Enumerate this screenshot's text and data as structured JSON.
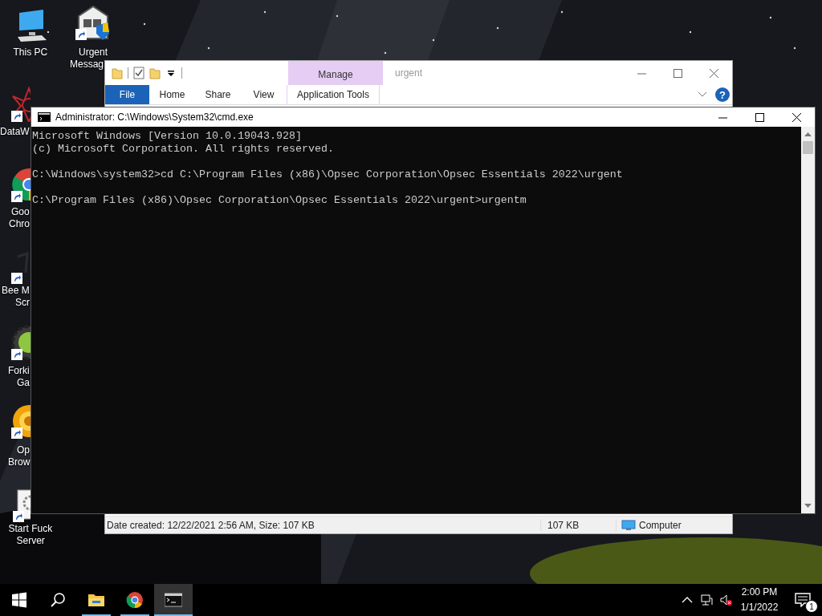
{
  "desktop": {
    "icons": [
      {
        "kind": "computer",
        "shortcut": false,
        "label": [
          "This PC"
        ]
      },
      {
        "kind": "house-shield",
        "shortcut": true,
        "label": [
          "Urgent",
          "Messag"
        ]
      },
      {
        "kind": "starburst",
        "shortcut": true,
        "label": [
          "DataW"
        ]
      },
      {
        "kind": "ring-ball",
        "shortcut": true,
        "label": [
          "Goo",
          "Chro"
        ]
      },
      {
        "kind": "faint",
        "shortcut": true,
        "label": [
          "Bee M",
          "Scr"
        ]
      },
      {
        "kind": "gear",
        "shortcut": true,
        "label": [
          "Forki",
          "Ga"
        ]
      },
      {
        "kind": "round-logo",
        "shortcut": true,
        "label": [
          "Op",
          "Brow"
        ]
      },
      {
        "kind": "gear-page",
        "shortcut": true,
        "label": [
          "Start Fuck",
          "Server"
        ]
      }
    ]
  },
  "explorer": {
    "context_tab": "Manage",
    "title": "urgent",
    "tabs": [
      {
        "label": "File",
        "kind": "file"
      },
      {
        "label": "Home",
        "kind": "plain"
      },
      {
        "label": "Share",
        "kind": "plain"
      },
      {
        "label": "View",
        "kind": "plain"
      },
      {
        "label": "Application Tools",
        "kind": "context"
      }
    ],
    "help": "?",
    "status_bar": {
      "details": "Date created: 12/22/2021 2:56 AM, Size: 107 KB",
      "size": "107 KB",
      "location": "Computer"
    }
  },
  "cmd": {
    "title": "Administrator: C:\\Windows\\System32\\cmd.exe",
    "blocks": [
      [
        "Microsoft Windows [Version 10.0.19043.928]",
        "(c) Microsoft Corporation. All rights reserved."
      ],
      [
        "C:\\Windows\\system32>cd C:\\Program Files (x86)\\Opsec Corporation\\Opsec Essentials 2022\\urgent"
      ],
      [
        "C:\\Program Files (x86)\\Opsec Corporation\\Opsec Essentials 2022\\urgent>urgentm"
      ]
    ]
  },
  "taskbar": {
    "apps": [
      {
        "kind": "folder",
        "running": true,
        "active": false
      },
      {
        "kind": "browser",
        "running": true,
        "active": false
      },
      {
        "kind": "console",
        "running": true,
        "active": true
      }
    ],
    "time": "2:00 PM",
    "date": "1/1/2022",
    "notifications": "1"
  }
}
